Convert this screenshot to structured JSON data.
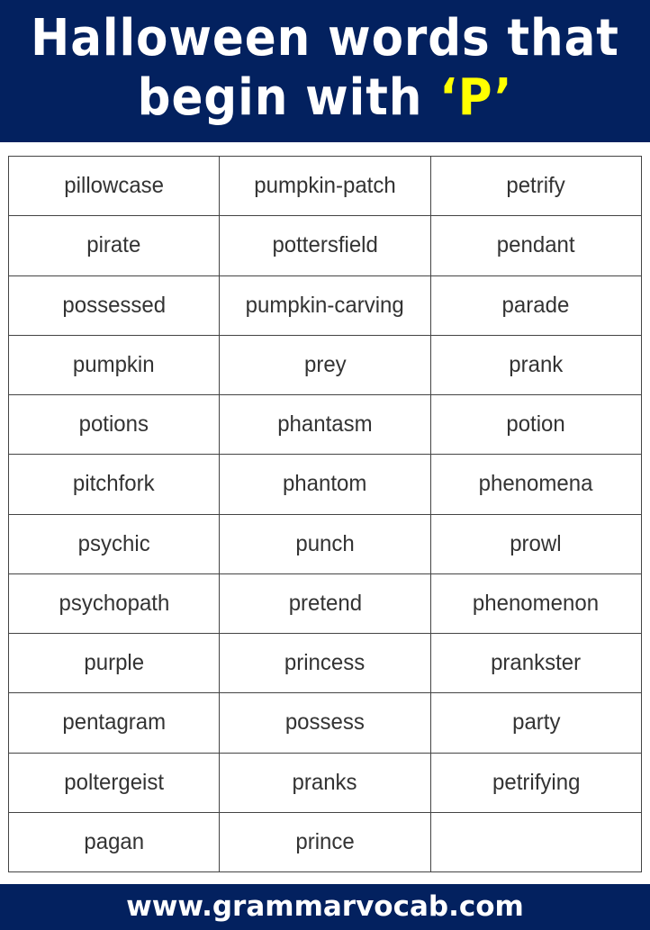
{
  "header": {
    "title_line1": "Halloween words that",
    "title_line2_prefix": "begin with ",
    "title_letter": "‘P’",
    "colors": {
      "background": "#03215f",
      "text": "#ffffff",
      "accent": "#ffff00"
    }
  },
  "table": {
    "rows": [
      [
        "pillowcase",
        "pumpkin-patch",
        "petrify"
      ],
      [
        "pirate",
        "pottersfield",
        "pendant"
      ],
      [
        "possessed",
        "pumpkin-carving",
        "parade"
      ],
      [
        "pumpkin",
        "prey",
        "prank"
      ],
      [
        "potions",
        "phantasm",
        "potion"
      ],
      [
        "pitchfork",
        "phantom",
        "phenomena"
      ],
      [
        "psychic",
        "punch",
        "prowl"
      ],
      [
        "psychopath",
        "pretend",
        "phenomenon"
      ],
      [
        "purple",
        "princess",
        "prankster"
      ],
      [
        "pentagram",
        "possess",
        "party"
      ],
      [
        "poltergeist",
        "pranks",
        "petrifying"
      ],
      [
        "pagan",
        "prince",
        ""
      ]
    ]
  },
  "footer": {
    "website": "www.grammarvocab.com"
  }
}
